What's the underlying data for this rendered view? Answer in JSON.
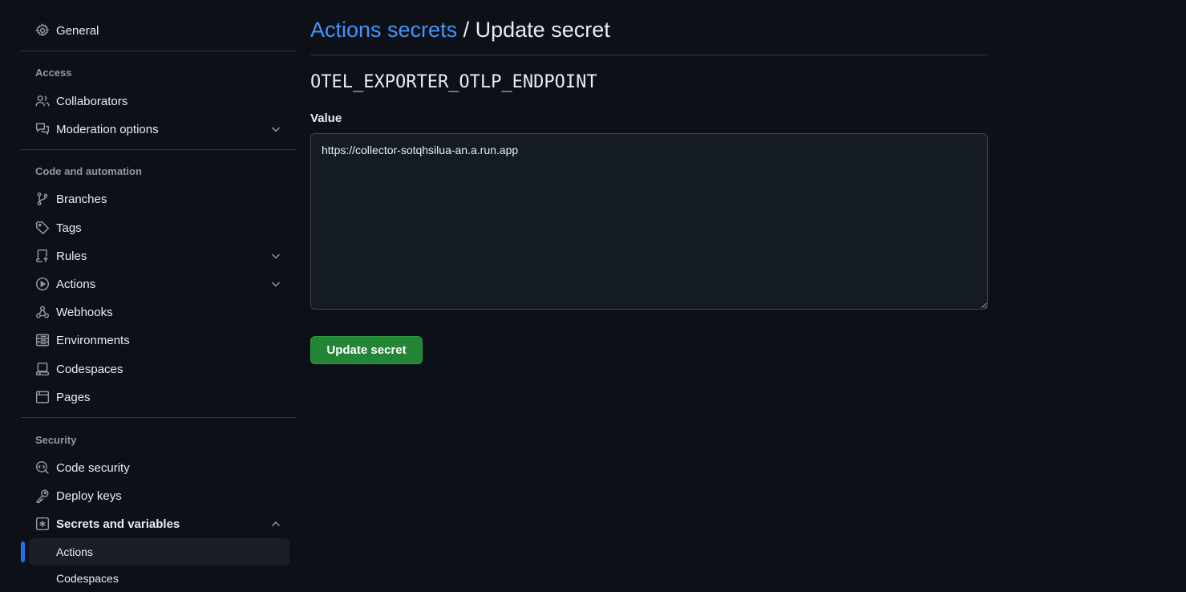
{
  "sidebar": {
    "general": {
      "label": "General",
      "icon": "gear-icon"
    },
    "access": {
      "heading": "Access",
      "items": [
        {
          "label": "Collaborators",
          "icon": "people-icon"
        },
        {
          "label": "Moderation options",
          "icon": "comment-discussion-icon",
          "expandable": true
        }
      ]
    },
    "code_automation": {
      "heading": "Code and automation",
      "items": [
        {
          "label": "Branches",
          "icon": "git-branch-icon"
        },
        {
          "label": "Tags",
          "icon": "tag-icon"
        },
        {
          "label": "Rules",
          "icon": "repo-push-icon",
          "expandable": true
        },
        {
          "label": "Actions",
          "icon": "play-icon",
          "expandable": true
        },
        {
          "label": "Webhooks",
          "icon": "webhook-icon"
        },
        {
          "label": "Environments",
          "icon": "server-icon"
        },
        {
          "label": "Codespaces",
          "icon": "codespaces-icon"
        },
        {
          "label": "Pages",
          "icon": "browser-icon"
        }
      ]
    },
    "security": {
      "heading": "Security",
      "items": [
        {
          "label": "Code security",
          "icon": "codescan-icon"
        },
        {
          "label": "Deploy keys",
          "icon": "key-icon"
        },
        {
          "label": "Secrets and variables",
          "icon": "key-asterisk-icon",
          "expanded": true
        }
      ],
      "sub_items": [
        {
          "label": "Actions",
          "active": true
        },
        {
          "label": "Codespaces",
          "active": false
        }
      ]
    }
  },
  "main": {
    "breadcrumb_link": "Actions secrets",
    "breadcrumb_sep": "/",
    "title": "Update secret",
    "secret_name": "OTEL_EXPORTER_OTLP_ENDPOINT",
    "value_label": "Value",
    "value": "https://collector-sotqhsilua-an.a.run.app",
    "submit_label": "Update secret"
  },
  "colors": {
    "background": "#0d1117",
    "link": "#4493f8",
    "primary_button": "#238636",
    "active_marker": "#1f6feb",
    "muted_text": "#9198a1",
    "border": "#30363d"
  }
}
